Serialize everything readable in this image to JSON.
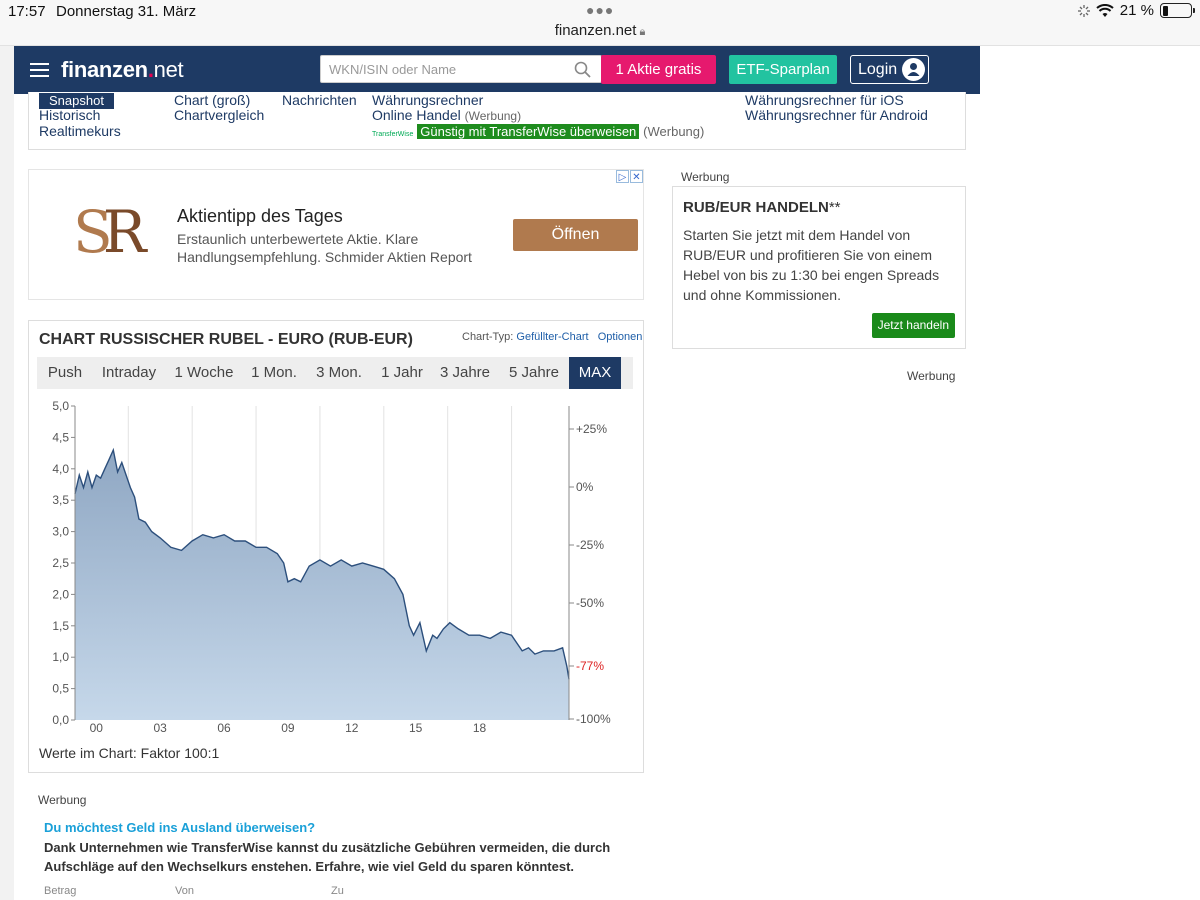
{
  "status_bar": {
    "time": "17:57",
    "date": "Donnerstag 31. März",
    "url": "finanzen.net",
    "battery": "21 %"
  },
  "header": {
    "logo_main": "finanzen",
    "logo_dot": ".",
    "logo_net": "net",
    "search_placeholder": "WKN/ISIN oder Name",
    "btn_aktie": "1 Aktie gratis",
    "btn_etf": "ETF-Sparplan",
    "btn_login": "Login"
  },
  "subnav": {
    "snapshot": "Snapshot",
    "historisch": "Historisch",
    "realtimekurs": "Realtimekurs",
    "chart_gross": "Chart (groß)",
    "chartvergleich": "Chartvergleich",
    "nachrichten": "Nachrichten",
    "waehrungsrechner": "Währungsrechner",
    "online_handel": "Online Handel",
    "werbung_tag": "(Werbung)",
    "transferwise_logo": "TransferWise",
    "transferwise_link": "Günstig mit TransferWise überweisen",
    "werbung_tag2": "(Werbung)",
    "ios": "Währungsrechner für iOS",
    "android": "Währungsrechner für Android"
  },
  "ad_top": {
    "logo_s": "S",
    "logo_r": "R",
    "title": "Aktientipp des Tages",
    "text": "Erstaunlich unterbewertete Aktie. Klare Handlungsempfehlung. Schmider Aktien Report",
    "button": "Öffnen"
  },
  "chart_panel": {
    "title": "CHART RUSSISCHER RUBEL - EURO (RUB-EUR)",
    "chart_type_label": "Chart-Typ:",
    "chart_type_value": "Gefüllter-Chart",
    "options": "Optionen",
    "tabs": [
      "Push",
      "Intraday",
      "1 Woche",
      "1 Mon.",
      "3 Mon.",
      "1 Jahr",
      "3 Jahre",
      "5 Jahre",
      "MAX"
    ],
    "active_tab": "MAX",
    "footer": "Werte im Chart: Faktor 100:1"
  },
  "chart_data": {
    "type": "area",
    "title": "",
    "xlabel": "",
    "ylabel": "",
    "x_ticks": [
      "00",
      "03",
      "06",
      "09",
      "12",
      "15",
      "18"
    ],
    "y_ticks": [
      "0,0",
      "0,5",
      "1,0",
      "1,5",
      "2,0",
      "2,5",
      "3,0",
      "3,5",
      "4,0",
      "4,5",
      "5,0"
    ],
    "y2_ticks": [
      "+25%",
      "0%",
      "-25%",
      "-50%",
      "-77%",
      "-100%"
    ],
    "ylim": [
      0,
      5
    ],
    "xlim": [
      1999,
      2022.2
    ],
    "grid": true,
    "x": [
      1999.0,
      1999.2,
      1999.4,
      1999.6,
      1999.8,
      2000.0,
      2000.2,
      2000.4,
      2000.6,
      2000.8,
      2001.0,
      2001.2,
      2001.4,
      2001.6,
      2001.8,
      2002.0,
      2002.3,
      2002.6,
      2003.0,
      2003.5,
      2004.0,
      2004.5,
      2005.0,
      2005.5,
      2006.0,
      2006.5,
      2007.0,
      2007.5,
      2008.0,
      2008.5,
      2008.8,
      2009.0,
      2009.3,
      2009.6,
      2010.0,
      2010.5,
      2011.0,
      2011.5,
      2012.0,
      2012.5,
      2013.0,
      2013.5,
      2014.0,
      2014.4,
      2014.7,
      2014.9,
      2015.2,
      2015.5,
      2015.8,
      2016.0,
      2016.3,
      2016.6,
      2017.0,
      2017.5,
      2018.0,
      2018.5,
      2019.0,
      2019.5,
      2020.0,
      2020.3,
      2020.6,
      2021.0,
      2021.5,
      2021.9,
      2022.1,
      2022.2
    ],
    "values": [
      3.6,
      3.9,
      3.7,
      3.95,
      3.7,
      3.9,
      3.85,
      4.0,
      4.15,
      4.3,
      3.95,
      4.1,
      3.9,
      3.7,
      3.55,
      3.2,
      3.15,
      3.0,
      2.9,
      2.75,
      2.7,
      2.85,
      2.95,
      2.9,
      2.95,
      2.85,
      2.85,
      2.75,
      2.75,
      2.65,
      2.5,
      2.2,
      2.25,
      2.2,
      2.45,
      2.55,
      2.45,
      2.55,
      2.45,
      2.5,
      2.45,
      2.4,
      2.25,
      2.0,
      1.5,
      1.35,
      1.55,
      1.1,
      1.35,
      1.3,
      1.45,
      1.55,
      1.45,
      1.35,
      1.35,
      1.3,
      1.4,
      1.35,
      1.1,
      1.15,
      1.05,
      1.1,
      1.1,
      1.15,
      0.85,
      0.65
    ],
    "last_change_label": "-77%"
  },
  "right_column": {
    "werbung1": "Werbung",
    "box_title": "RUB/EUR HANDELN",
    "box_title_suffix": "**",
    "box_text": "Starten Sie jetzt mit dem Handel von RUB/EUR und profitieren Sie von einem Hebel von bis zu 1:30 bei engen Spreads und ohne Kommissionen.",
    "box_button": "Jetzt handeln",
    "werbung2": "Werbung"
  },
  "bottom": {
    "werbung": "Werbung",
    "question": "Du möchtest Geld ins Ausland überweisen?",
    "text": "Dank Unternehmen wie TransferWise kannst du zusätzliche Gebühren vermeiden, die durch Aufschläge auf den Wechselkurs enstehen. Erfahre, wie viel Geld du sparen könntest.",
    "label_betrag": "Betrag",
    "label_von": "Von",
    "label_zu": "Zu"
  },
  "colors": {
    "navy": "#1e3a64",
    "pink": "#e6196e",
    "teal": "#22c3a0",
    "green": "#1a8a1a",
    "bronze": "#b07a4e",
    "area_fill_top": "#8fa7c3",
    "area_fill_bottom": "#c6d8ea",
    "line": "#2c4f7c",
    "negative": "#d22"
  }
}
